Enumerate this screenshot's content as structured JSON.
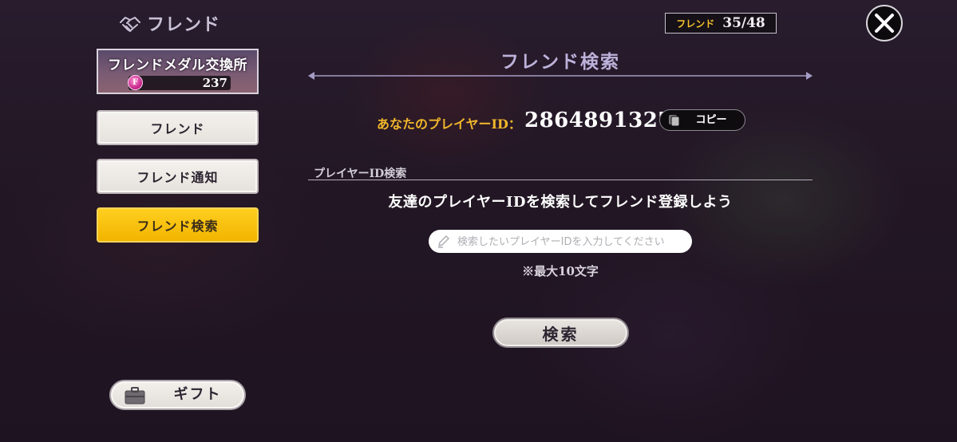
{
  "header": {
    "title": "フレンド",
    "icon": "handshake-icon"
  },
  "friend_count": {
    "label": "フレンド",
    "value": "35/48"
  },
  "close": {
    "icon": "close-icon"
  },
  "sidebar": {
    "medal_exchange": {
      "title": "フレンドメダル交換所",
      "coin_glyph": "F",
      "amount": "237"
    },
    "items": [
      {
        "label": "フレンド",
        "active": false
      },
      {
        "label": "フレンド通知",
        "active": false
      },
      {
        "label": "フレンド検索",
        "active": true
      }
    ],
    "gift": {
      "label": "ギフト",
      "icon": "briefcase-icon"
    }
  },
  "main": {
    "title": "フレンド検索",
    "player_id_label": "あなたのプレイヤーID：",
    "player_id": "2864891327",
    "copy_label": "コピー",
    "section_label": "プレイヤーID検索",
    "instruction": "友達のプレイヤーIDを検索してフレンド登録しよう",
    "search_placeholder": "検索したいプレイヤーIDを入力してください",
    "search_value": "",
    "note": "※最大10文字",
    "search_button": "検索"
  },
  "colors": {
    "accent_gold": "#f2b400",
    "id_label_gold": "#f1b72b",
    "title_lavender": "#bdb2da",
    "background": "#2b1f2e"
  }
}
